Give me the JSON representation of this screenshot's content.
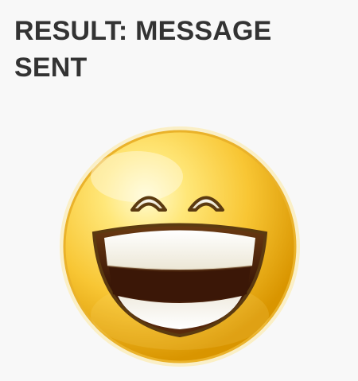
{
  "result": {
    "title": "RESULT: MESSAGE SENT"
  },
  "emoji": {
    "icon": "laughing-face-icon",
    "colors": {
      "face_light": "#fff9c8",
      "face_mid": "#f7c530",
      "face_dark": "#d49500",
      "mouth_dark": "#4a2109",
      "teeth": "#ffffff",
      "outline": "#5b3a10"
    }
  }
}
